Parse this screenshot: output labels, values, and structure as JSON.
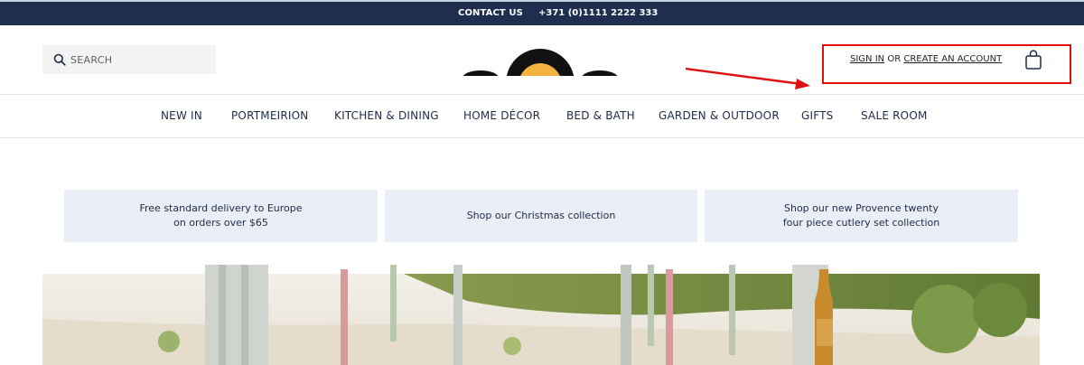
{
  "topbar": {
    "contact_label": "CONTACT US",
    "phone": "+371 (0)1111 2222 333"
  },
  "header": {
    "search_placeholder": "SEARCH",
    "sign_in_label": "SIGN IN",
    "or_label": "OR",
    "create_account_label": "CREATE AN ACCOUNT"
  },
  "nav": {
    "items": [
      {
        "label": "NEW IN"
      },
      {
        "label": "PORTMEIRION"
      },
      {
        "label": "KITCHEN & DINING"
      },
      {
        "label": "HOME DÉCOR"
      },
      {
        "label": "BED & BATH"
      },
      {
        "label": "GARDEN & OUTDOOR"
      },
      {
        "label": "GIFTS"
      },
      {
        "label": "SALE ROOM"
      }
    ]
  },
  "promos": [
    {
      "text": "Free standard delivery to Europe\non orders over $65"
    },
    {
      "text": "Shop our Christmas collection"
    },
    {
      "text": "Shop our new Provence twenty\nfour piece cutlery set collection"
    }
  ],
  "colors": {
    "topbar_bg": "#1f2e4f",
    "promo_bg": "#e9eef7",
    "annotation_red": "#e01010",
    "logo_accent": "#f4b23f"
  },
  "icons": {
    "search": "search-icon",
    "bag": "shopping-bag-icon"
  }
}
